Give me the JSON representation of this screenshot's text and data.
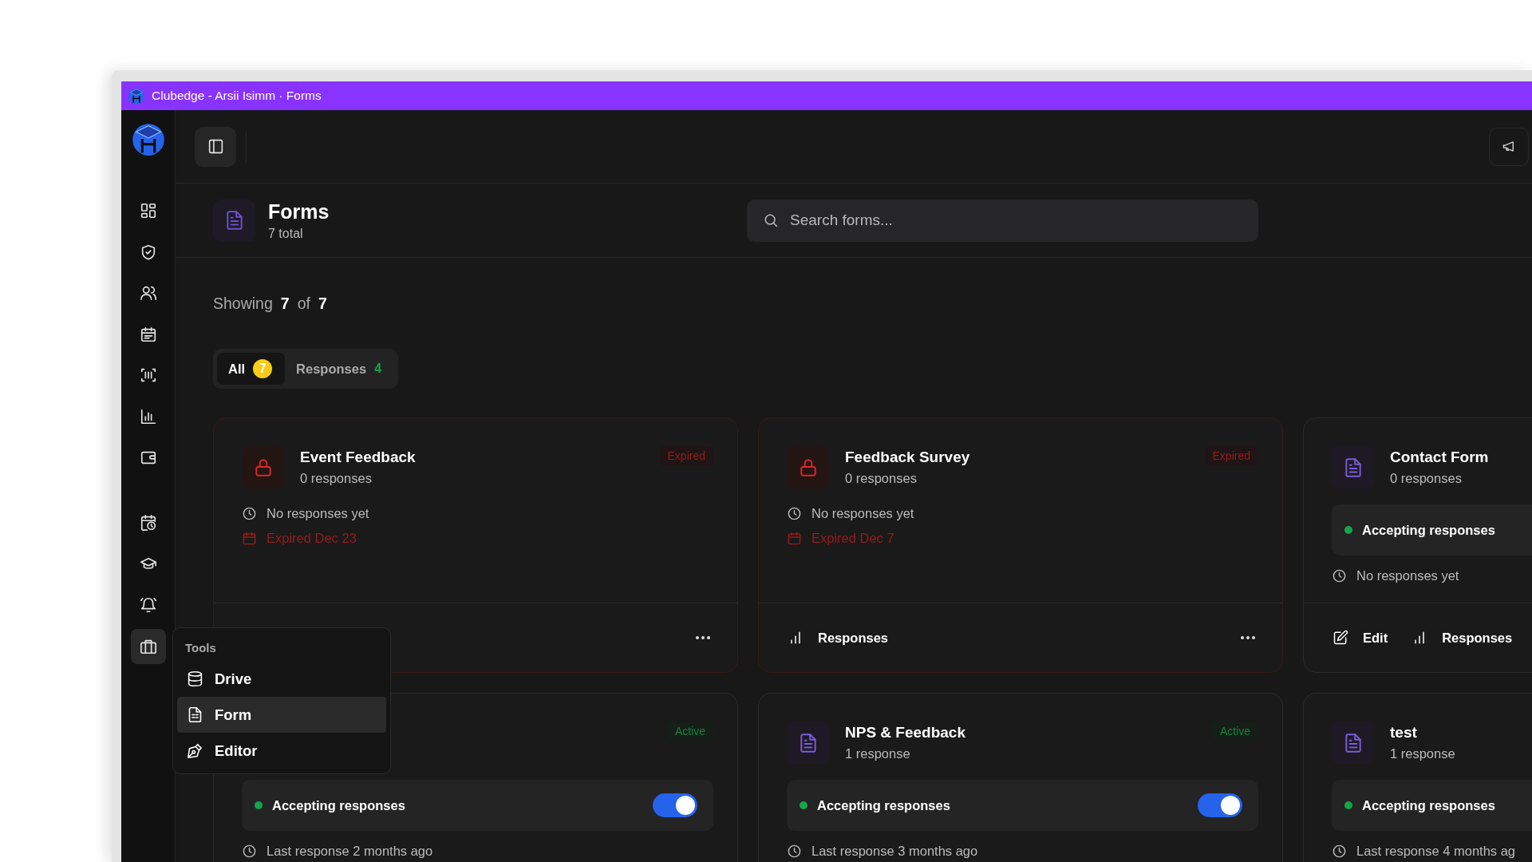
{
  "window": {
    "title": "Clubedge - Arsii Isimm · Forms"
  },
  "sidebar": {
    "top_items": [
      {
        "kind": "grid",
        "selected": false
      },
      {
        "kind": "shield",
        "selected": false
      },
      {
        "kind": "users",
        "selected": false
      },
      {
        "kind": "calendar",
        "selected": false
      },
      {
        "kind": "scan",
        "selected": false
      },
      {
        "kind": "chart",
        "selected": false
      },
      {
        "kind": "wallet",
        "selected": false
      }
    ],
    "bottom_items": [
      {
        "kind": "calclock",
        "selected": false
      },
      {
        "kind": "cap",
        "selected": false
      },
      {
        "kind": "bell",
        "selected": false
      },
      {
        "kind": "briefcase",
        "selected": true
      }
    ]
  },
  "header": {
    "title": "Forms",
    "subtitle": "7 total"
  },
  "search": {
    "placeholder": "Search forms..."
  },
  "showing": {
    "label": "Showing",
    "shown": "7",
    "of": "of",
    "total": "7"
  },
  "tabs": [
    {
      "label": "All",
      "count": "7",
      "color": "#facc15",
      "selected": true
    },
    {
      "label": "Responses",
      "count": "4",
      "color": "#16a34a",
      "selected": false
    }
  ],
  "cards": [
    {
      "kind": "expired",
      "title": "Event Feedback",
      "subtitle": "0 responses",
      "badge": "Expired",
      "lines": [
        {
          "kind": "clock",
          "text": "No responses yet"
        },
        {
          "kind": "expiry",
          "text": "Expired Dec 23"
        }
      ],
      "more": true
    },
    {
      "kind": "expired",
      "title": "Feedback Survey",
      "subtitle": "0 responses",
      "badge": "Expired",
      "lines": [
        {
          "kind": "clock",
          "text": "No responses yet"
        },
        {
          "kind": "expiry",
          "text": "Expired Dec 7"
        }
      ],
      "actions": [
        {
          "kind": "responses",
          "label": "Responses"
        }
      ],
      "more": true
    },
    {
      "kind": "form",
      "title": "Contact Form",
      "subtitle": "0 responses",
      "accepting": {
        "label": "Accepting responses"
      },
      "lines": [
        {
          "kind": "clock",
          "text": "No responses yet"
        }
      ],
      "actions": [
        {
          "kind": "edit",
          "label": "Edit"
        },
        {
          "kind": "responses",
          "label": "Responses"
        }
      ]
    },
    {
      "kind": "active",
      "badge": "Active",
      "accepting": {
        "label": "Accepting responses",
        "on": true
      },
      "lines": [
        {
          "kind": "clock",
          "text": "Last response 2 months ago"
        }
      ]
    },
    {
      "kind": "active",
      "title": "NPS & Feedback",
      "subtitle": "1 response",
      "badge": "Active",
      "accepting": {
        "label": "Accepting responses",
        "on": true
      },
      "lines": [
        {
          "kind": "clock",
          "text": "Last response 3 months ago"
        }
      ]
    },
    {
      "kind": "form",
      "title": "test",
      "subtitle": "1 response",
      "accepting": {
        "label": "Accepting responses"
      },
      "lines": [
        {
          "kind": "clock",
          "text": "Last response 4 months ag"
        }
      ]
    }
  ],
  "tools_menu": {
    "heading": "Tools",
    "items": [
      {
        "kind": "database",
        "label": "Drive",
        "selected": false
      },
      {
        "kind": "form",
        "label": "Form",
        "selected": true
      },
      {
        "kind": "pen",
        "label": "Editor",
        "selected": false
      }
    ]
  }
}
